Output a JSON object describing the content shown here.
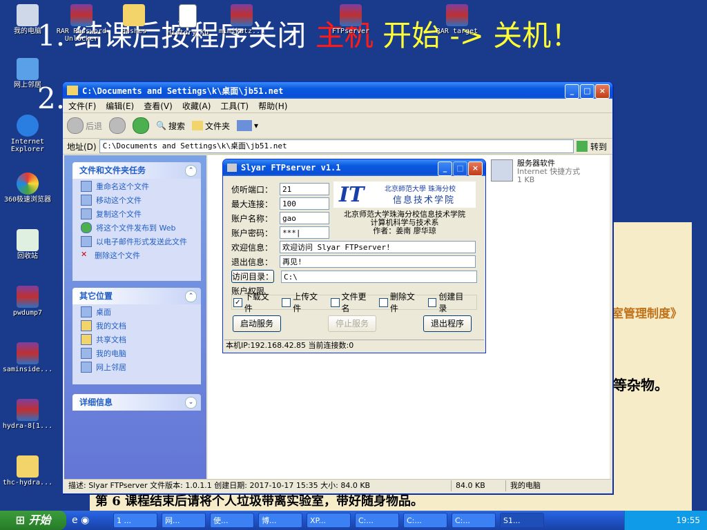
{
  "slide": {
    "line1_prefix": "1. 结课后按程序关闭",
    "line1_red": "主机",
    "line1_suffix": "开始 -> 关机！",
    "line2": "2.",
    "right_text1": "室管理制度》",
    "right_text2": "等杂物。",
    "bottom_text": "第 6  课程结束后请将个人垃圾带离实验室，带好随身物品。"
  },
  "desktop_icons": [
    {
      "label": "我的电脑",
      "icon": "computer-icon"
    },
    {
      "label": "网上邻居",
      "icon": "network-icon"
    },
    {
      "label": "Internet Explorer",
      "icon": "ie-icon"
    },
    {
      "label": "360极速浏览器",
      "icon": "browser-icon"
    },
    {
      "label": "回收站",
      "icon": "recycle-bin-icon"
    },
    {
      "label": "pwdump7",
      "icon": "rar-icon"
    },
    {
      "label": "saminside...",
      "icon": "rar-icon"
    },
    {
      "label": "hydra-8[1...",
      "icon": "rar-icon"
    },
    {
      "label": "thc-hydra...",
      "icon": "folder-icon"
    },
    {
      "label": "RAR Password Unlocker",
      "icon": "rar-icon"
    },
    {
      "label": "Hashes",
      "icon": "folder-icon"
    },
    {
      "label": "History_Ku",
      "icon": "document-icon"
    },
    {
      "label": "mimikatz...",
      "icon": "rar-icon"
    },
    {
      "label": "FTPserver",
      "icon": "rar-icon"
    },
    {
      "label": "RAR target",
      "icon": "rar-icon"
    }
  ],
  "explorer": {
    "title": "C:\\Documents and Settings\\k\\桌面\\jb51.net",
    "menu": [
      "文件(F)",
      "编辑(E)",
      "查看(V)",
      "收藏(A)",
      "工具(T)",
      "帮助(H)"
    ],
    "toolbar": {
      "back": "后退",
      "search": "搜索",
      "folders": "文件夹"
    },
    "address_label": "地址(D)",
    "address_value": "C:\\Documents and Settings\\k\\桌面\\jb51.net",
    "go_label": "转到",
    "tasks_panel": {
      "title": "文件和文件夹任务",
      "items": [
        "重命名这个文件",
        "移动这个文件",
        "复制这个文件",
        "将这个文件发布到 Web",
        "以电子邮件形式发送此文件",
        "删除这个文件"
      ]
    },
    "places_panel": {
      "title": "其它位置",
      "items": [
        "桌面",
        "我的文档",
        "共享文档",
        "我的电脑",
        "网上邻居"
      ]
    },
    "details_panel": {
      "title": "详细信息"
    },
    "file_item": {
      "name": "服务器软件",
      "type": "Internet 快捷方式",
      "size": "1 KB"
    },
    "status": {
      "description": "描述: Slyar FTPserver 文件版本: 1.0.1.1 创建日期: 2017-10-17 15:35 大小: 84.0 KB",
      "size": "84.0 KB",
      "location": "我的电脑"
    }
  },
  "ftp": {
    "title": "Slyar FTPserver v1.1",
    "fields": {
      "port_label": "侦听端口：",
      "port": "21",
      "maxconn_label": "最大连接：",
      "maxconn": "100",
      "user_label": "账户名称：",
      "user": "gao",
      "pass_label": "账户密码：",
      "pass": "***|",
      "welcome_label": "欢迎信息：",
      "welcome": "欢迎访问 Slyar FTPserver!",
      "exit_label": "退出信息：",
      "exit": "再见!",
      "dir_label": "访问目录：",
      "dir": "C:\\"
    },
    "logo_text": "IT",
    "logo_school": "北京師范大學 珠海分校",
    "logo_dept": "信息技术学院",
    "info_line1": "北京师范大学珠海分校信息技术学院",
    "info_line2": "计算机科学与技术系",
    "info_line3": "作者：姜南 廖华琼",
    "perm_title": "账户权限",
    "perms": [
      {
        "label": "下载文件",
        "checked": true
      },
      {
        "label": "上传文件",
        "checked": false
      },
      {
        "label": "文件更名",
        "checked": false
      },
      {
        "label": "删除文件",
        "checked": false
      },
      {
        "label": "创建目录",
        "checked": false
      }
    ],
    "start_btn": "启动服务",
    "stop_btn": "停止服务",
    "exit_btn": "退出程序",
    "status": "本机IP:192.168.42.85 当前连接数:0"
  },
  "taskbar": {
    "start": "开始",
    "tasks": [
      "1 ...",
      "网...",
      "使...",
      "博...",
      "XP...",
      "C:...",
      "C:...",
      "C:...",
      "S1..."
    ],
    "clock": "19:55"
  }
}
